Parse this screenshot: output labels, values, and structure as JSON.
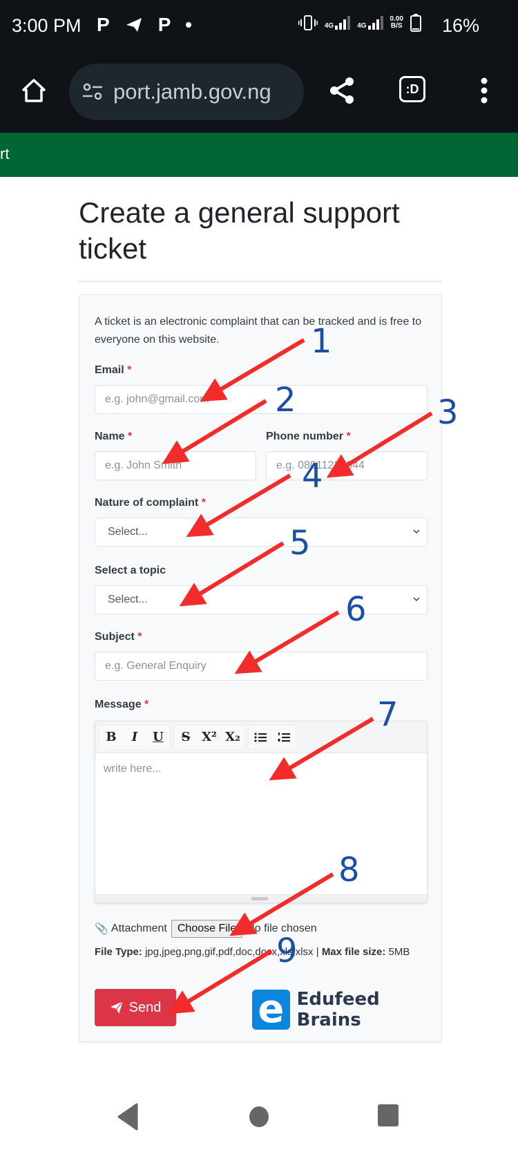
{
  "status_bar": {
    "time": "3:00 PM",
    "left_icons": [
      "p-app-icon",
      "telegram-icon",
      "p-app-icon",
      "notification-dot"
    ],
    "network_1": "4G",
    "network_2": "4G",
    "speed_value": "0.00",
    "speed_unit": "B/S",
    "battery_percent": "16%"
  },
  "browser": {
    "url": "port.jamb.gov.ng",
    "tab_switcher_label": ":D"
  },
  "site_nav": {
    "partial_label": "rt",
    "color": "#006633"
  },
  "page": {
    "title": "Create a general support ticket"
  },
  "form": {
    "intro": "A ticket is an electronic complaint that can be tracked and is free to everyone on this website.",
    "required_marker": "*",
    "email": {
      "label": "Email",
      "placeholder": "e.g. john@gmail.com",
      "value": ""
    },
    "name": {
      "label": "Name",
      "placeholder": "e.g. John Smith",
      "value": ""
    },
    "phone": {
      "label": "Phone number",
      "placeholder": "e.g. 08011223344",
      "value": ""
    },
    "complaint": {
      "label": "Nature of complaint",
      "selected": "Select..."
    },
    "topic": {
      "label": "Select a topic",
      "selected": "Select..."
    },
    "subject": {
      "label": "Subject",
      "placeholder": "e.g. General Enquiry",
      "value": ""
    },
    "message": {
      "label": "Message",
      "placeholder": "write here...",
      "toolbar": [
        "B",
        "I",
        "U",
        "S",
        "X²",
        "X₂",
        "bulleted-list",
        "numbered-list"
      ]
    },
    "attachment": {
      "label": "Attachment",
      "button": "Choose File",
      "status": "No file chosen"
    },
    "file_type_label": "File Type:",
    "file_types": "jpg,jpeg,png,gif,pdf,doc,docx,xls,xlsx",
    "separator": "|",
    "max_size_label": "Max file size:",
    "max_size": "5MB",
    "send_label": "Send",
    "send_color": "#dc3545"
  },
  "watermark": {
    "logo_letter": "e",
    "name": "Edufeed Brains",
    "color": "#0a86e0"
  },
  "annotations": [
    "1",
    "2",
    "3",
    "4",
    "5",
    "6",
    "7",
    "8",
    "9"
  ]
}
